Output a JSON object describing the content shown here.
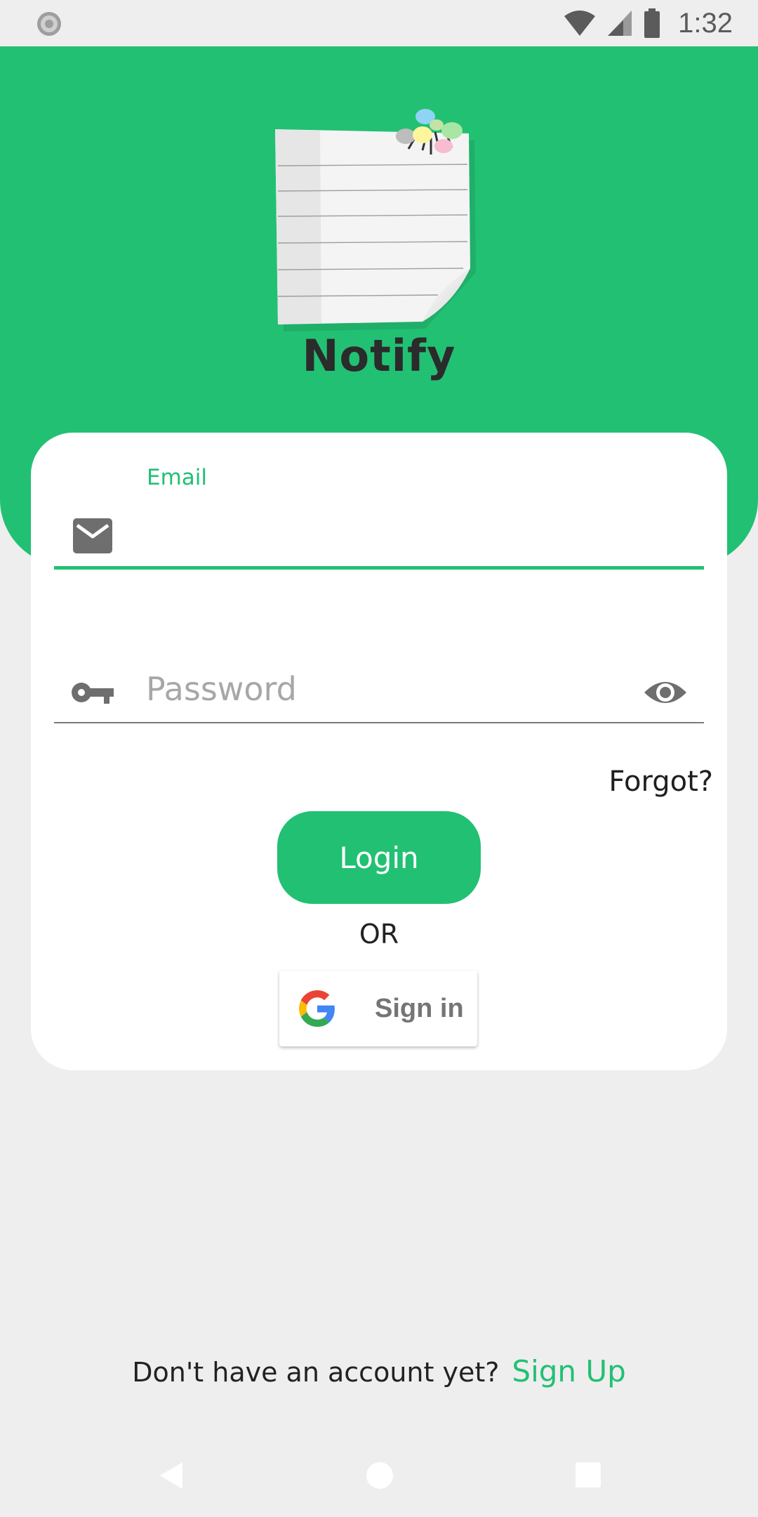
{
  "status_bar": {
    "time": "1:32",
    "icons": [
      "notification-icon",
      "wifi-icon",
      "signal-icon",
      "battery-icon"
    ]
  },
  "header": {
    "app_name": "Notify",
    "logo_icon": "notepad-with-pins-icon"
  },
  "login_form": {
    "email": {
      "label": "Email",
      "value": "",
      "icon": "email-icon"
    },
    "password": {
      "placeholder": "Password",
      "value": "",
      "icon": "key-icon",
      "toggle_icon": "eye-icon"
    },
    "forgot_label": "Forgot?",
    "login_label": "Login",
    "or_label": "OR",
    "google": {
      "label": "Sign in",
      "icon": "google-icon"
    }
  },
  "signup": {
    "prompt": "Don't have an account yet?",
    "link_label": "Sign Up"
  },
  "colors": {
    "accent": "#22C073",
    "background": "#EEEEEE",
    "card": "#FFFFFF",
    "text": "#222222"
  },
  "nav_bar": {
    "icons": [
      "back-icon",
      "home-icon",
      "recents-icon"
    ]
  }
}
